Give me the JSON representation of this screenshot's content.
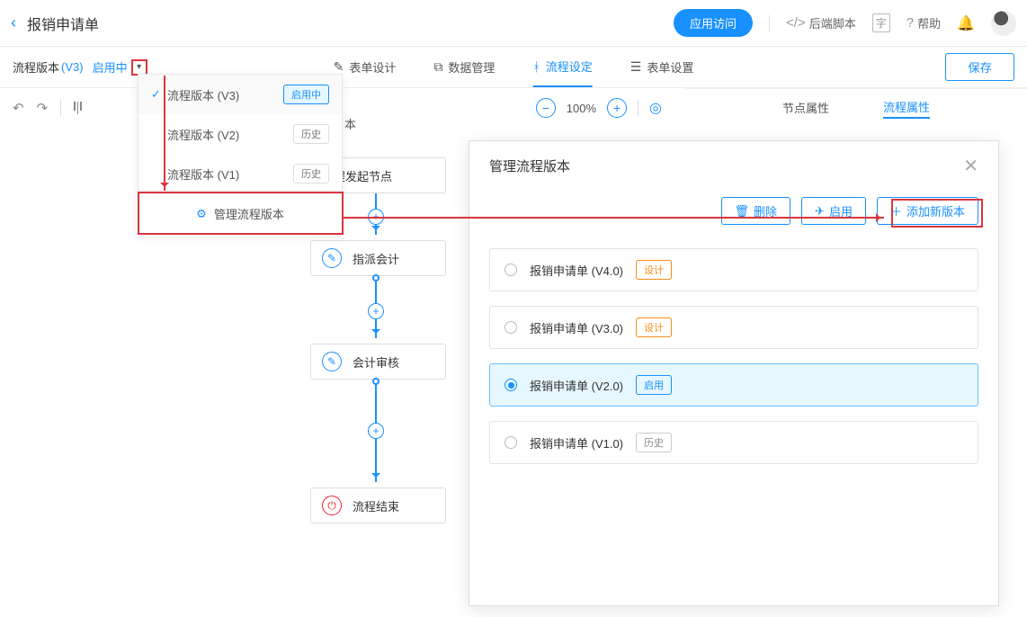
{
  "header": {
    "title": "报销申请单",
    "btn_access": "应用访问",
    "link_backend": "后端脚本",
    "link_help": "帮助"
  },
  "subheader": {
    "version_label": "流程版本",
    "version_value": "(V3)",
    "version_status": "启用中",
    "tab_form_design": "表单设计",
    "tab_data_mgmt": "数据管理",
    "tab_flow_setting": "流程设定",
    "tab_form_setting": "表单设置",
    "btn_save": "保存"
  },
  "toolbar": {
    "zoom_pct": "100%"
  },
  "right_pane": {
    "tab_node_attr": "节点属性",
    "tab_flow_attr": "流程属性"
  },
  "dropdown": {
    "items": [
      {
        "label": "流程版本 (V3)",
        "badge": "启用中",
        "badge_type": "active",
        "checked": true
      },
      {
        "label": "流程版本 (V2)",
        "badge": "历史",
        "badge_type": "history",
        "checked": false
      },
      {
        "label": "流程版本 (V1)",
        "badge": "历史",
        "badge_type": "history",
        "checked": false
      }
    ],
    "manage_label": "管理流程版本"
  },
  "flow": {
    "start": "流程发起节点",
    "n2": "指派会计",
    "n3": "会计审核",
    "end": "流程结束",
    "truncated_version": "本"
  },
  "modal": {
    "title": "管理流程版本",
    "btn_delete": "删除",
    "btn_enable": "启用",
    "btn_add": "添加新版本",
    "versions": [
      {
        "label": "报销申请单 (V4.0)",
        "badge": "设计",
        "badge_type": "design",
        "selected": false
      },
      {
        "label": "报销申请单 (V3.0)",
        "badge": "设计",
        "badge_type": "design",
        "selected": false
      },
      {
        "label": "报销申请单 (V2.0)",
        "badge": "启用",
        "badge_type": "enable",
        "selected": true
      },
      {
        "label": "报销申请单 (V1.0)",
        "badge": "历史",
        "badge_type": "history",
        "selected": false
      }
    ]
  }
}
